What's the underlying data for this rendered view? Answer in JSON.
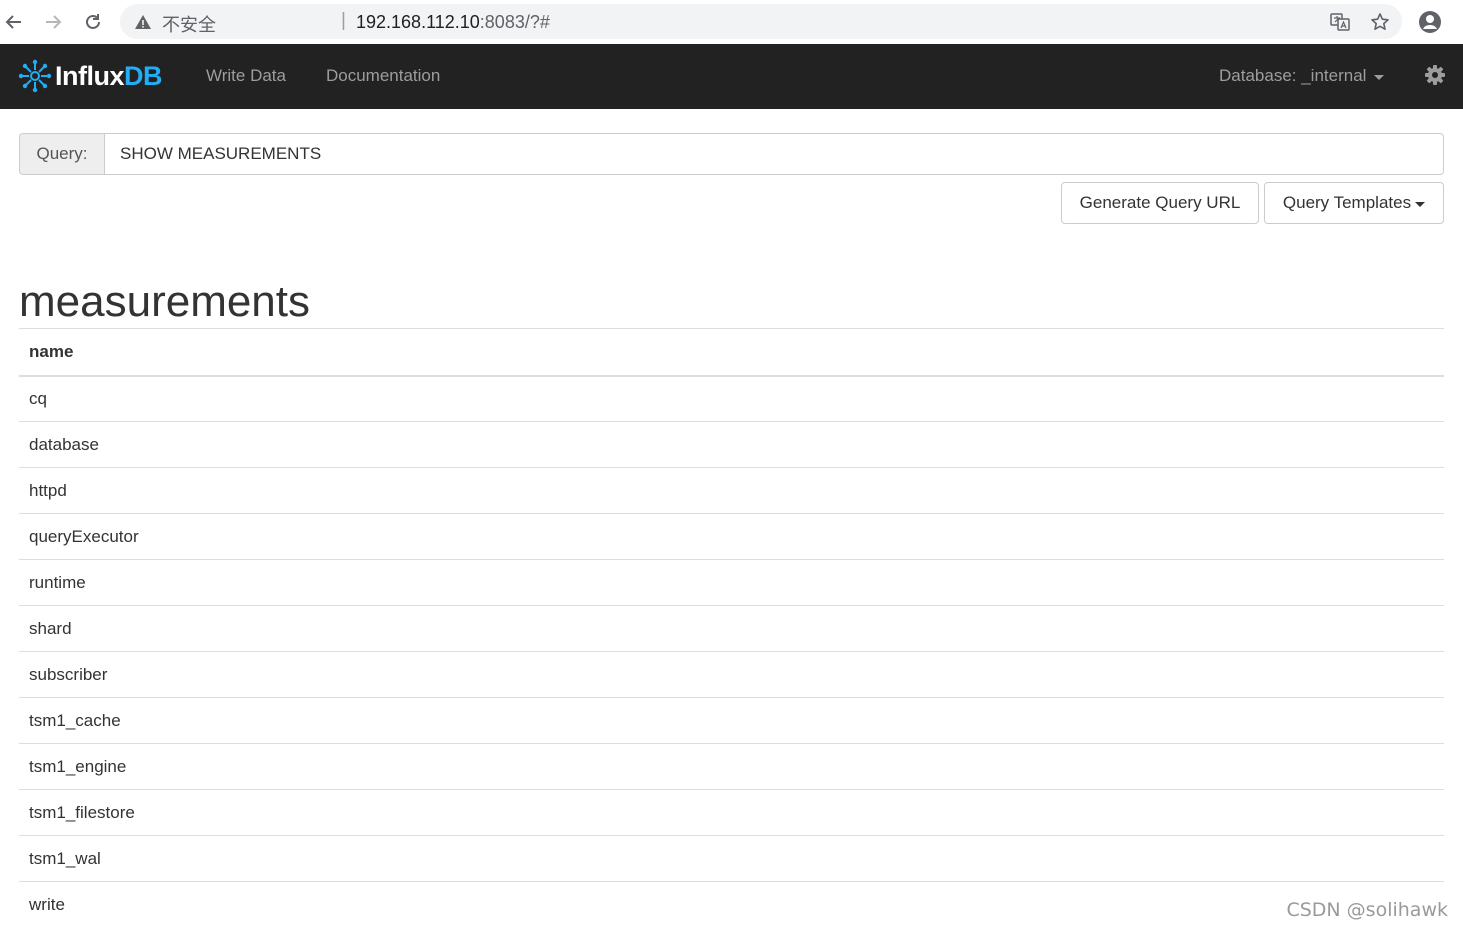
{
  "browser": {
    "security_label": "不安全",
    "separator": "|",
    "url_host": "192.168.112.10",
    "url_path": ":8083/?#"
  },
  "navbar": {
    "brand_main": "Influx",
    "brand_accent": "DB",
    "links": [
      "Write Data",
      "Documentation"
    ],
    "database_label": "Database: _internal",
    "brand_color": "#22adf6",
    "background": "#222222"
  },
  "query": {
    "addon_label": "Query:",
    "value": "SHOW MEASUREMENTS",
    "generate_url_label": "Generate Query URL",
    "templates_label": "Query Templates"
  },
  "result": {
    "title": "measurements",
    "columns": [
      "name"
    ],
    "rows": [
      "cq",
      "database",
      "httpd",
      "queryExecutor",
      "runtime",
      "shard",
      "subscriber",
      "tsm1_cache",
      "tsm1_engine",
      "tsm1_filestore",
      "tsm1_wal",
      "write"
    ]
  },
  "watermark": "CSDN @solihawk"
}
